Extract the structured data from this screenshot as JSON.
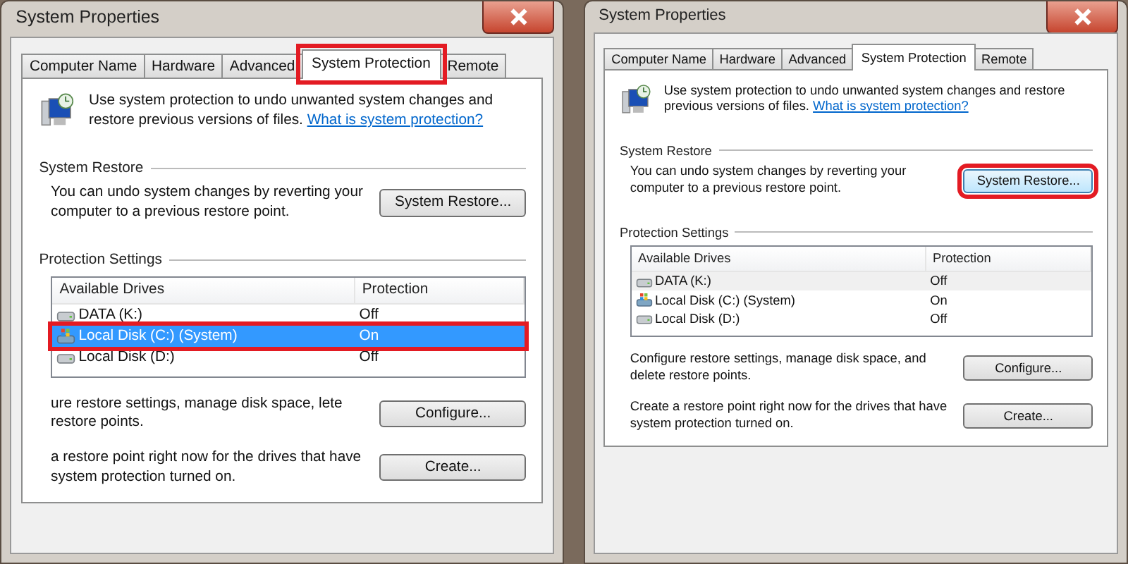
{
  "dialogs": [
    {
      "title": "System Properties",
      "tabs": [
        {
          "label": "Computer Name",
          "selected": false,
          "highlighted": false
        },
        {
          "label": "Hardware",
          "selected": false,
          "highlighted": false
        },
        {
          "label": "Advanced",
          "selected": false,
          "highlighted": false
        },
        {
          "label": "System Protection",
          "selected": true,
          "highlighted": true
        },
        {
          "label": "Remote",
          "selected": false,
          "highlighted": false
        }
      ],
      "intro": {
        "text": "Use system protection to undo unwanted system changes and restore previous versions of files.",
        "link": "What is system protection?"
      },
      "system_restore": {
        "heading": "System Restore",
        "text": "You can undo system changes by reverting your computer to a previous restore point.",
        "button": {
          "label": "System Restore...",
          "highlighted": false
        }
      },
      "protection_settings": {
        "heading": "Protection Settings",
        "columns": [
          "Available Drives",
          "Protection"
        ],
        "rows": [
          {
            "drive": "DATA (K:)",
            "protection": "Off",
            "kind": "disk",
            "selected": false,
            "hovered": false,
            "highlighted": false
          },
          {
            "drive": "Local Disk (C:) (System)",
            "protection": "On",
            "kind": "system",
            "selected": true,
            "hovered": false,
            "highlighted": true
          },
          {
            "drive": "Local Disk (D:)",
            "protection": "Off",
            "kind": "disk",
            "selected": false,
            "hovered": false,
            "highlighted": false
          }
        ],
        "configure": {
          "text": "ure restore settings, manage disk space, lete restore points.",
          "button": {
            "label": "Configure...",
            "highlighted": false
          }
        },
        "create": {
          "text": "a restore point right now for the drives that have system protection turned on.",
          "button": {
            "label": "Create...",
            "highlighted": false
          }
        }
      }
    },
    {
      "title": "System Properties",
      "tabs": [
        {
          "label": "Computer Name",
          "selected": false,
          "highlighted": false
        },
        {
          "label": "Hardware",
          "selected": false,
          "highlighted": false
        },
        {
          "label": "Advanced",
          "selected": false,
          "highlighted": false
        },
        {
          "label": "System Protection",
          "selected": true,
          "highlighted": false
        },
        {
          "label": "Remote",
          "selected": false,
          "highlighted": false
        }
      ],
      "intro": {
        "text": "Use system protection to undo unwanted system changes and restore previous versions of files.",
        "link": "What is system protection?"
      },
      "system_restore": {
        "heading": "System Restore",
        "text": "You can undo system changes by reverting your computer to a previous restore point.",
        "button": {
          "label": "System Restore...",
          "highlighted": true
        }
      },
      "protection_settings": {
        "heading": "Protection Settings",
        "columns": [
          "Available Drives",
          "Protection"
        ],
        "rows": [
          {
            "drive": "DATA (K:)",
            "protection": "Off",
            "kind": "disk",
            "selected": false,
            "hovered": true,
            "highlighted": false
          },
          {
            "drive": "Local Disk (C:) (System)",
            "protection": "On",
            "kind": "system",
            "selected": false,
            "hovered": false,
            "highlighted": false
          },
          {
            "drive": "Local Disk (D:)",
            "protection": "Off",
            "kind": "disk",
            "selected": false,
            "hovered": false,
            "highlighted": false
          }
        ],
        "configure": {
          "text": "Configure restore settings, manage disk space, and delete restore points.",
          "button": {
            "label": "Configure...",
            "highlighted": false
          }
        },
        "create": {
          "text": "Create a restore point right now for the drives that have system protection turned on.",
          "button": {
            "label": "Create...",
            "highlighted": false
          }
        }
      }
    }
  ]
}
